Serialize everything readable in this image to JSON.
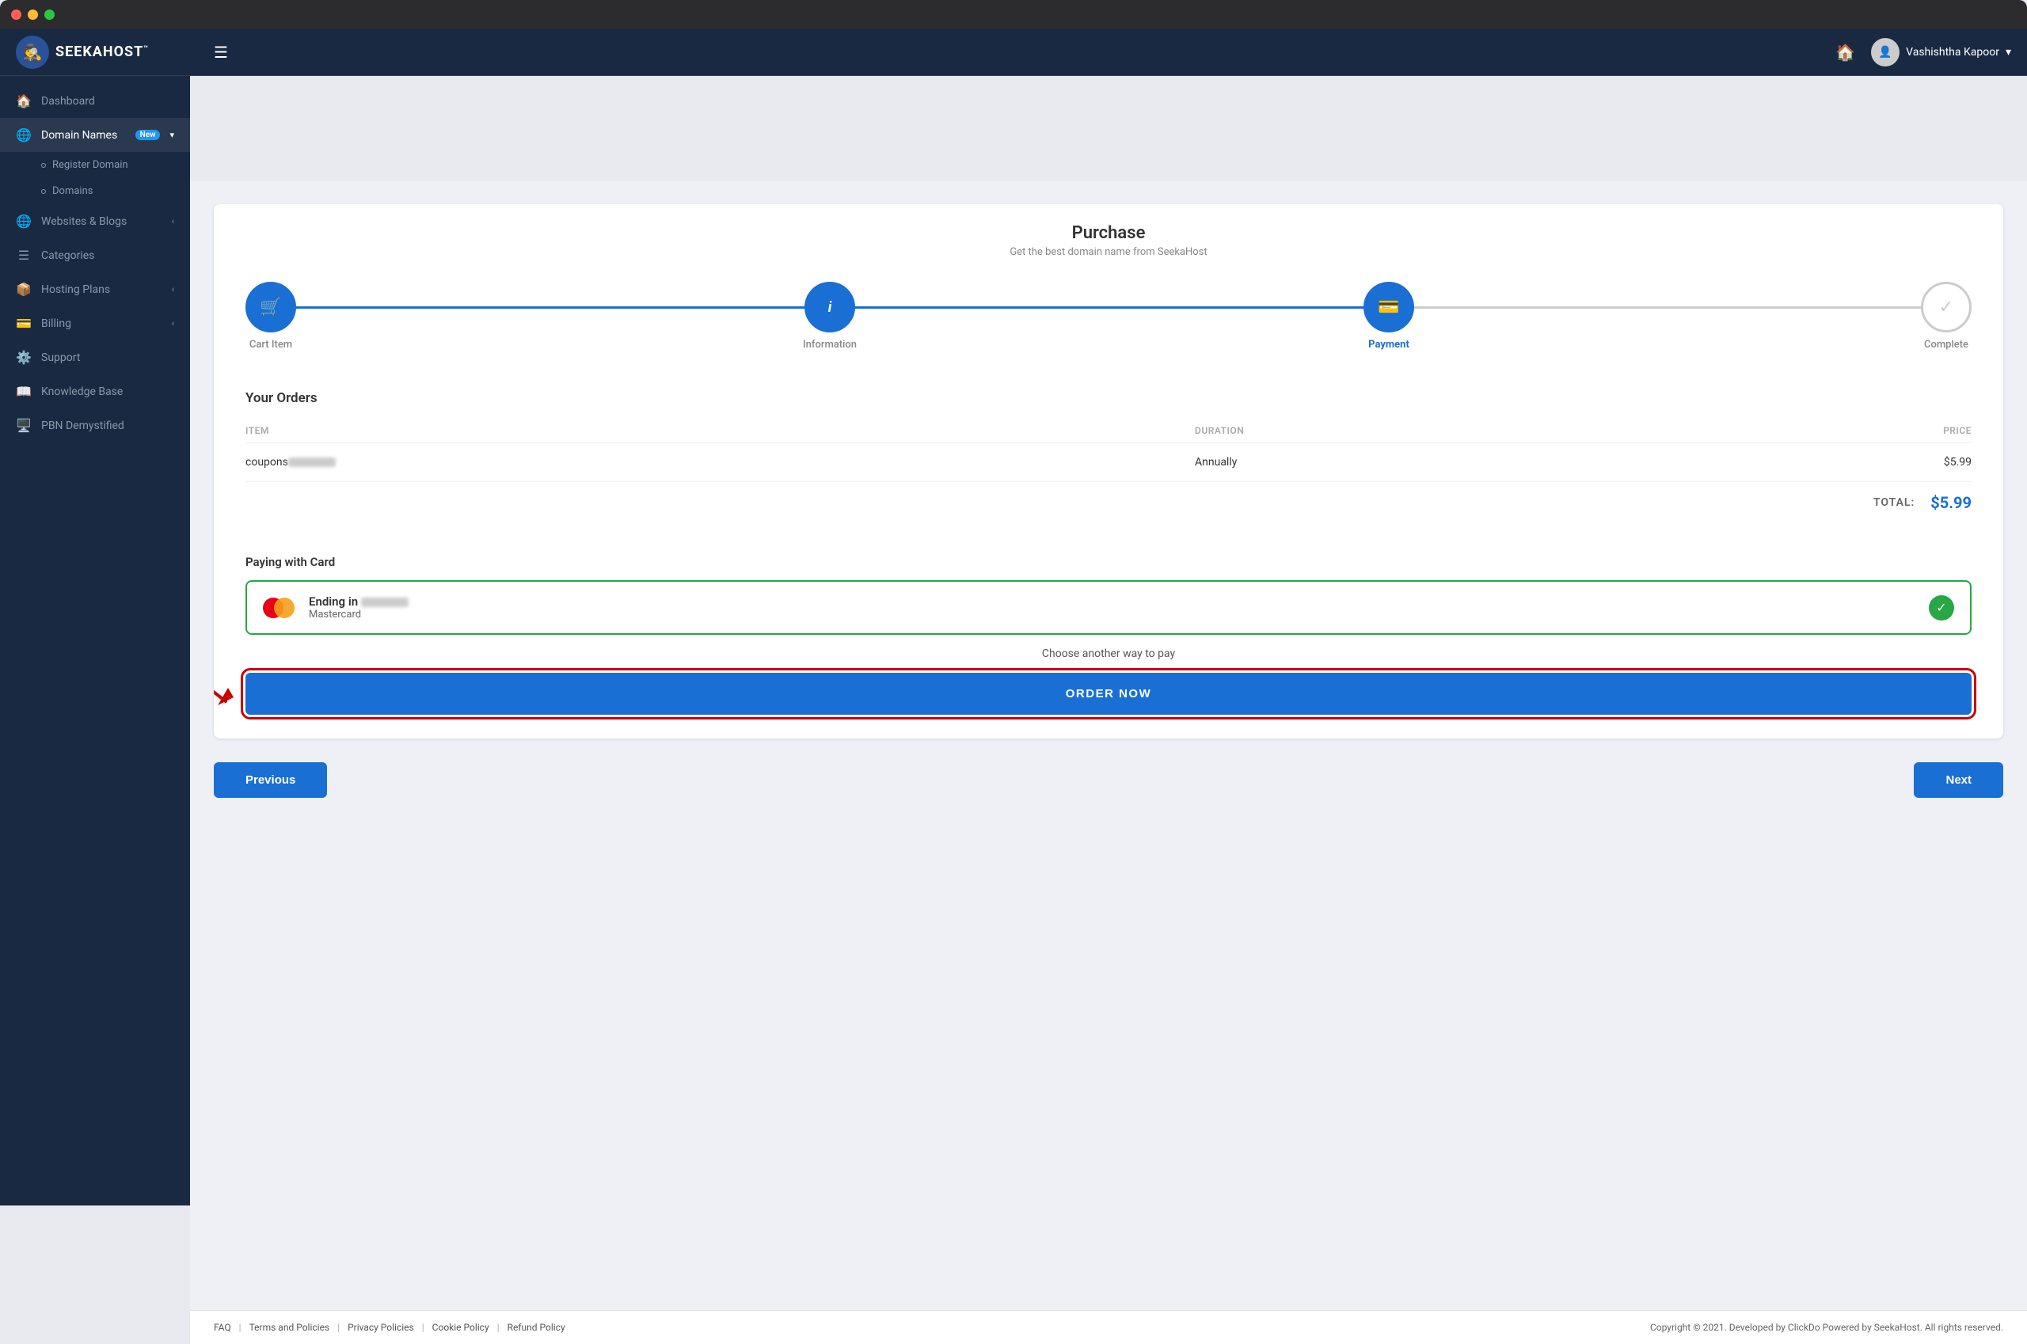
{
  "window": {
    "title": "SeekaHost"
  },
  "topbar": {
    "logo_text": "SEEKAHOST",
    "logo_tm": "™",
    "user_name": "Vashishtha Kapoor",
    "home_label": "Home"
  },
  "sidebar": {
    "items": [
      {
        "id": "dashboard",
        "label": "Dashboard",
        "icon": "🏠",
        "active": false
      },
      {
        "id": "domain-names",
        "label": "Domain Names",
        "icon": "🌐",
        "badge": "New",
        "active": true,
        "expanded": true
      },
      {
        "id": "register-domain",
        "label": "Register Domain",
        "sub": true
      },
      {
        "id": "domains",
        "label": "Domains",
        "sub": true
      },
      {
        "id": "websites-blogs",
        "label": "Websites & Blogs",
        "icon": "🌐",
        "active": false,
        "chevron": true
      },
      {
        "id": "categories",
        "label": "Categories",
        "icon": "☰",
        "active": false
      },
      {
        "id": "hosting-plans",
        "label": "Hosting Plans",
        "icon": "📦",
        "active": false,
        "chevron": true
      },
      {
        "id": "billing",
        "label": "Billing",
        "icon": "💳",
        "active": false,
        "chevron": true
      },
      {
        "id": "support",
        "label": "Support",
        "icon": "⚙️",
        "active": false
      },
      {
        "id": "knowledge-base",
        "label": "Knowledge Base",
        "icon": "📖",
        "active": false
      },
      {
        "id": "pbn-demystified",
        "label": "PBN Demystified",
        "icon": "🖥️",
        "active": false
      }
    ]
  },
  "page": {
    "title": "Purchase",
    "subtitle": "Get the best domain name from SeekaHost"
  },
  "stepper": {
    "steps": [
      {
        "id": "cart-item",
        "label": "Cart Item",
        "icon": "🛒",
        "state": "done"
      },
      {
        "id": "information",
        "label": "Information",
        "icon": "ℹ",
        "state": "done"
      },
      {
        "id": "payment",
        "label": "Payment",
        "icon": "💳",
        "state": "active"
      },
      {
        "id": "complete",
        "label": "Complete",
        "icon": "✓",
        "state": "inactive"
      }
    ]
  },
  "orders": {
    "title": "Your Orders",
    "columns": {
      "item": "ITEM",
      "duration": "DURATION",
      "price": "PRICE"
    },
    "rows": [
      {
        "item": "coupons",
        "item_blurred": true,
        "duration": "Annually",
        "price": "$5.99"
      }
    ],
    "total_label": "TOTAL:",
    "total_amount": "$5.99"
  },
  "payment": {
    "section_title": "Paying with Card",
    "card_ending_label": "Ending in",
    "card_ending_blurred": true,
    "card_type": "Mastercard",
    "choose_another": "Choose another way to pay",
    "order_button": "ORDER NOW"
  },
  "nav": {
    "previous": "Previous",
    "next": "Next"
  },
  "footer": {
    "links": [
      {
        "label": "FAQ"
      },
      {
        "label": "Terms and Policies"
      },
      {
        "label": "Privacy Policies"
      },
      {
        "label": "Cookie Policy"
      },
      {
        "label": "Refund Policy"
      }
    ],
    "copyright": "Copyright © 2021. Developed by ClickDo Powered by SeekaHost. All rights reserved."
  }
}
